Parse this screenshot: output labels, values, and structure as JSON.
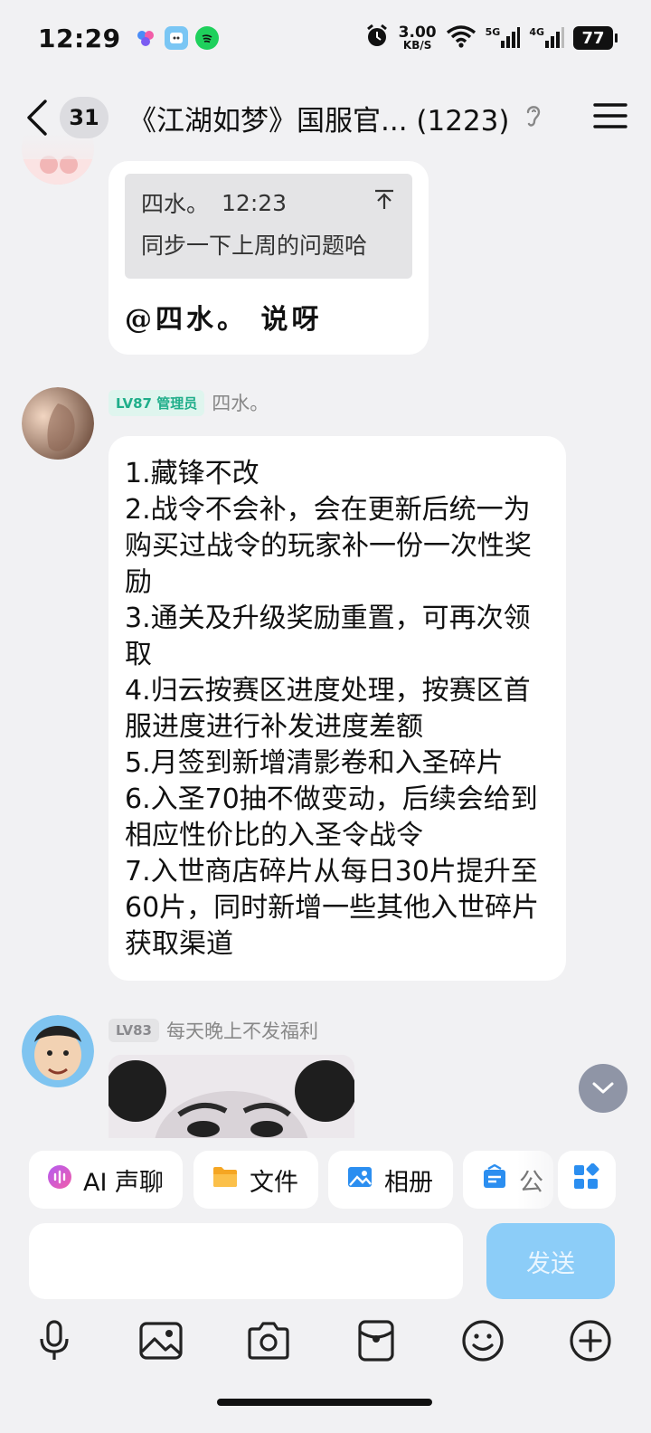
{
  "status_bar": {
    "time": "12:29",
    "net_speed": "3.00",
    "net_unit": "KB/S",
    "signal1": "5G",
    "signal2": "4G",
    "battery": "77"
  },
  "nav": {
    "unread_count": "31",
    "title": "《江湖如梦》国服官... (1223)"
  },
  "messages": [
    {
      "quote_name": "四水。",
      "quote_time": "12:23",
      "quote_text": "同步一下上周的问题哈",
      "reply_text": "@四水。 说呀"
    },
    {
      "level": "LV87 管理员",
      "name": "四水。",
      "text": "1.藏锋不改\n2.战令不会补，会在更新后统一为购买过战令的玩家补一份一次性奖励\n3.通关及升级奖励重置，可再次领取\n4.归云按赛区进度处理，按赛区首服进度进行补发进度差额\n5.月签到新增清影卷和入圣碎片\n6.入圣70抽不做变动，后续会给到相应性价比的入圣令战令\n7.入世商店碎片从每日30片提升至60片，同时新增一些其他入世碎片获取渠道"
    },
    {
      "level": "LV83",
      "name": "每天晚上不发福利"
    }
  ],
  "quick_actions": [
    {
      "label": "AI 声聊",
      "icon": "ai-voice-icon"
    },
    {
      "label": "文件",
      "icon": "folder-icon"
    },
    {
      "label": "相册",
      "icon": "album-icon"
    },
    {
      "label": "公",
      "icon": "announcement-icon"
    }
  ],
  "input": {
    "placeholder": "",
    "send_label": "发送"
  },
  "colors": {
    "admin_badge_bg": "#dff5ee",
    "admin_badge_fg": "#1fae8a",
    "level_badge_bg": "#e4e4e6",
    "level_badge_fg": "#8a8a8e",
    "send_button": "#8ccdf8"
  }
}
